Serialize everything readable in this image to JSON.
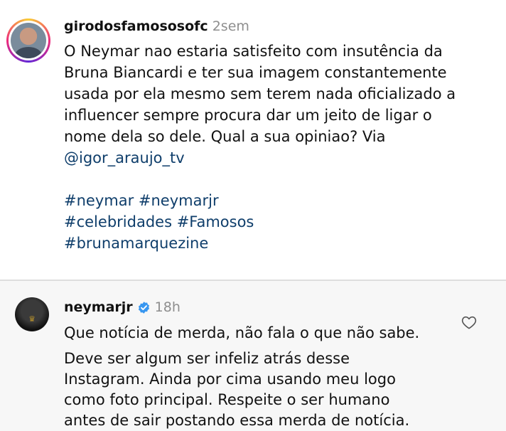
{
  "post": {
    "username": "girodosfamososofc",
    "time": "2sem",
    "caption_lines": [
      "O Neymar nao estaria satisfeito com insutência da",
      "Bruna Biancardi e ter sua imagem constantemente",
      "usada por ela mesmo sem terem nada oficializado a",
      "influencer sempre procura dar um jeito de ligar o",
      "nome dela so dele. Qual a sua opiniao? Via"
    ],
    "mention": "@igor_araujo_tv",
    "hashtag_lines": [
      [
        "#neymar",
        "#neymarjr"
      ],
      [
        "#celebridades",
        "#Famosos"
      ],
      [
        "#brunamarquezine"
      ]
    ]
  },
  "reply": {
    "username": "neymarjr",
    "time": "18h",
    "line1": "Que notícia de merda, não fala o que não sabe.",
    "paragraph2_lines": [
      "Deve ser algum ser infeliz atrás desse",
      "Instagram. Ainda por cima usando meu logo",
      "como foto principal. Respeite o ser humano",
      "antes de sair postando essa merda de notícia."
    ]
  },
  "colors": {
    "link": "#0f3e6b",
    "verified": "#3897f0",
    "muted": "#8e8e8e"
  },
  "icons": {
    "verified": "verified-badge-icon",
    "like": "heart-outline-icon"
  }
}
